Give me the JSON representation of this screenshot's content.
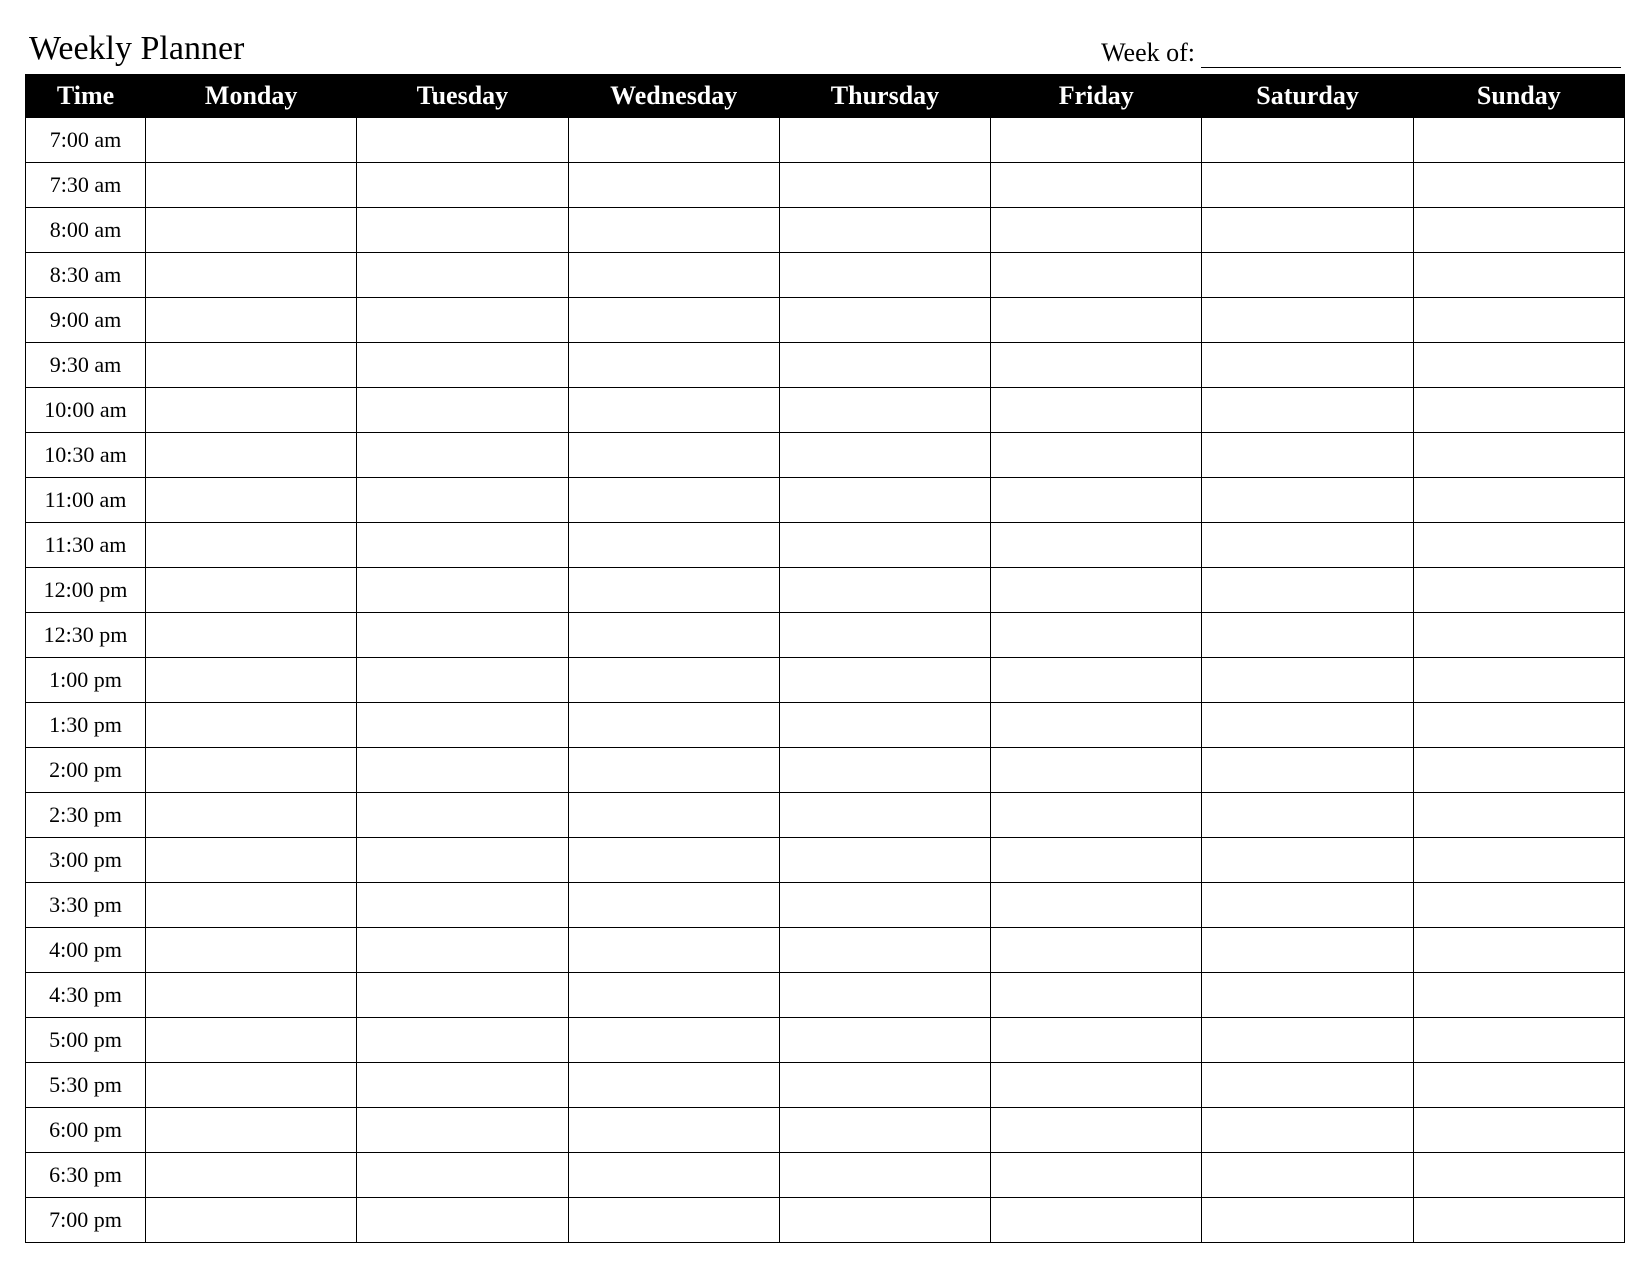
{
  "title": "Weekly Planner",
  "week_of_label": "Week of:",
  "columns": {
    "time": "Time",
    "days": [
      "Monday",
      "Tuesday",
      "Wednesday",
      "Thursday",
      "Friday",
      "Saturday",
      "Sunday"
    ]
  },
  "time_slots": [
    "7:00 am",
    "7:30 am",
    "8:00 am",
    "8:30 am",
    "9:00 am",
    "9:30 am",
    "10:00 am",
    "10:30 am",
    "11:00 am",
    "11:30 am",
    "12:00 pm",
    "12:30 pm",
    "1:00 pm",
    "1:30 pm",
    "2:00 pm",
    "2:30 pm",
    "3:00 pm",
    "3:30 pm",
    "4:00 pm",
    "4:30 pm",
    "5:00 pm",
    "5:30 pm",
    "6:00 pm",
    "6:30 pm",
    "7:00 pm"
  ]
}
